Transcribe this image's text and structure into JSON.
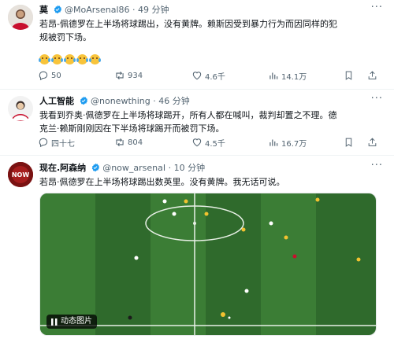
{
  "tweets": [
    {
      "name": "莫",
      "handle": "@MoArsenal86",
      "time": "· 49 分钟",
      "text_line1": "若昂-佩德罗在上半场将球踢出，没有黄牌。赖斯因受到暴力行为而因同样的犯",
      "text_line2": "规被罚下场。",
      "emoji_line": "😂😂😂😂😂",
      "replies": "50",
      "retweets": "934",
      "likes": "4.6千",
      "views": "14.1万"
    },
    {
      "name": "人工智能",
      "handle": "@nonewthing",
      "time": "· 46 分钟",
      "text_line1": "我看到乔奥·佩德罗在上半场将球踢开，所有人都在喊叫，裁判却置之不理。德",
      "text_line2": "克兰·赖斯刚刚因在下半场将球踢开而被罚下场。",
      "replies": "四十七",
      "retweets": "804",
      "likes": "4.5千",
      "views": "16.7万"
    },
    {
      "name": "现在.阿森纳",
      "handle": "@now_arsenaI",
      "time": "· 10 分钟",
      "text_line1": "若昂·佩德罗在上半场将球踢出数英里。没有黄牌。我无话可说。",
      "gif_label": "动态图片",
      "avatar_text": "NOW"
    }
  ],
  "colors": {
    "verified": "#1d9bf0",
    "muted": "#536471",
    "pitch_dark": "#2f6a2c",
    "pitch_light": "#3b7d35"
  }
}
